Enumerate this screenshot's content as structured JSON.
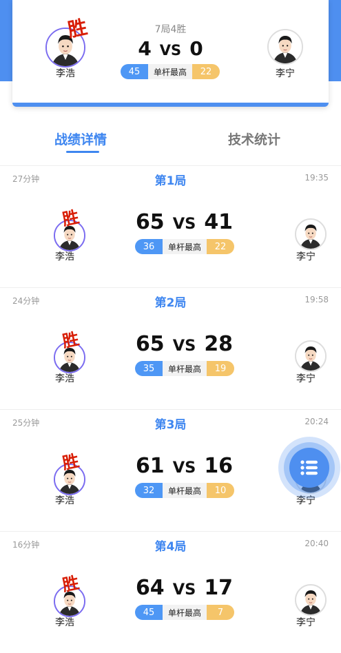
{
  "summary": {
    "subtitle": "7局4胜",
    "left_player": "李浩",
    "right_player": "李宁",
    "left_score": "4",
    "vs": "VS",
    "right_score": "0",
    "left_break": "45",
    "break_label": "单杆最高",
    "right_break": "22",
    "win_mark": "胜"
  },
  "tabs": {
    "details": "战绩详情",
    "stats": "技术统计"
  },
  "games": [
    {
      "duration": "27分钟",
      "title": "第1局",
      "time": "19:35",
      "left_score": "65",
      "vs": "VS",
      "right_score": "41",
      "left_break": "36",
      "break_label": "单杆最高",
      "right_break": "22",
      "left_player": "李浩",
      "right_player": "李宁",
      "win_mark": "胜"
    },
    {
      "duration": "24分钟",
      "title": "第2局",
      "time": "19:58",
      "left_score": "65",
      "vs": "VS",
      "right_score": "28",
      "left_break": "35",
      "break_label": "单杆最高",
      "right_break": "19",
      "left_player": "李浩",
      "right_player": "李宁",
      "win_mark": "胜"
    },
    {
      "duration": "25分钟",
      "title": "第3局",
      "time": "20:24",
      "left_score": "61",
      "vs": "VS",
      "right_score": "16",
      "left_break": "32",
      "break_label": "单杆最高",
      "right_break": "10",
      "left_player": "李浩",
      "right_player": "李宁",
      "win_mark": "胜"
    },
    {
      "duration": "16分钟",
      "title": "第4局",
      "time": "20:40",
      "left_score": "64",
      "vs": "VS",
      "right_score": "17",
      "left_break": "45",
      "break_label": "单杆最高",
      "right_break": "7",
      "left_player": "李浩",
      "right_player": "李宁",
      "win_mark": "胜"
    }
  ],
  "fab_icon": "list-icon",
  "colors": {
    "accent": "#4e8ff0",
    "win": "#d81e06",
    "break_gold": "#f5c56a"
  }
}
